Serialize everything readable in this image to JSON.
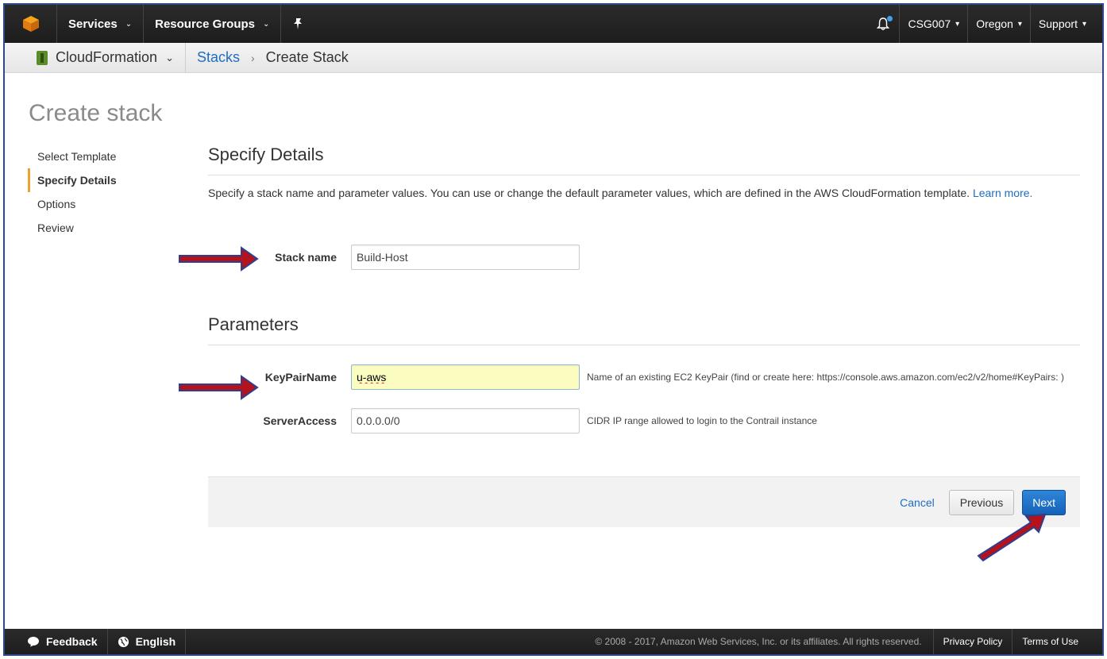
{
  "topnav": {
    "services_label": "Services",
    "resource_groups_label": "Resource Groups",
    "account_label": "CSG007",
    "region_label": "Oregon",
    "support_label": "Support"
  },
  "subnav": {
    "service_label": "CloudFormation",
    "breadcrumb_link": "Stacks",
    "breadcrumb_separator": "›",
    "breadcrumb_current": "Create Stack"
  },
  "page": {
    "title": "Create stack",
    "steps": [
      {
        "label": "Select Template"
      },
      {
        "label": "Specify Details"
      },
      {
        "label": "Options"
      },
      {
        "label": "Review"
      }
    ]
  },
  "details": {
    "section_title": "Specify Details",
    "description": "Specify a stack name and parameter values. You can use or change the default parameter values, which are defined in the AWS CloudFormation template.",
    "learn_more": "Learn more.",
    "stack_name_label": "Stack name",
    "stack_name_value": "Build-Host"
  },
  "parameters": {
    "section_title": "Parameters",
    "keypair_label": "KeyPairName",
    "keypair_value": "u-aws",
    "keypair_hint": "Name of an existing EC2 KeyPair (find or create here: https://console.aws.amazon.com/ec2/v2/home#KeyPairs: )",
    "server_access_label": "ServerAccess",
    "server_access_value": "0.0.0.0/0",
    "server_access_hint": "CIDR IP range allowed to login to the Contrail instance"
  },
  "actions": {
    "cancel_label": "Cancel",
    "previous_label": "Previous",
    "next_label": "Next"
  },
  "bottombar": {
    "feedback_label": "Feedback",
    "language_label": "English",
    "copyright": "© 2008 - 2017, Amazon Web Services, Inc. or its affiliates. All rights reserved.",
    "privacy_label": "Privacy Policy",
    "terms_label": "Terms of Use"
  },
  "colors": {
    "accent_link": "#1f6dbf",
    "primary_button": "#1563b8",
    "active_step_bar": "#f0a02f",
    "annotation_arrow": "#b5121b",
    "annotation_arrow_outline": "#2e3f8f"
  }
}
